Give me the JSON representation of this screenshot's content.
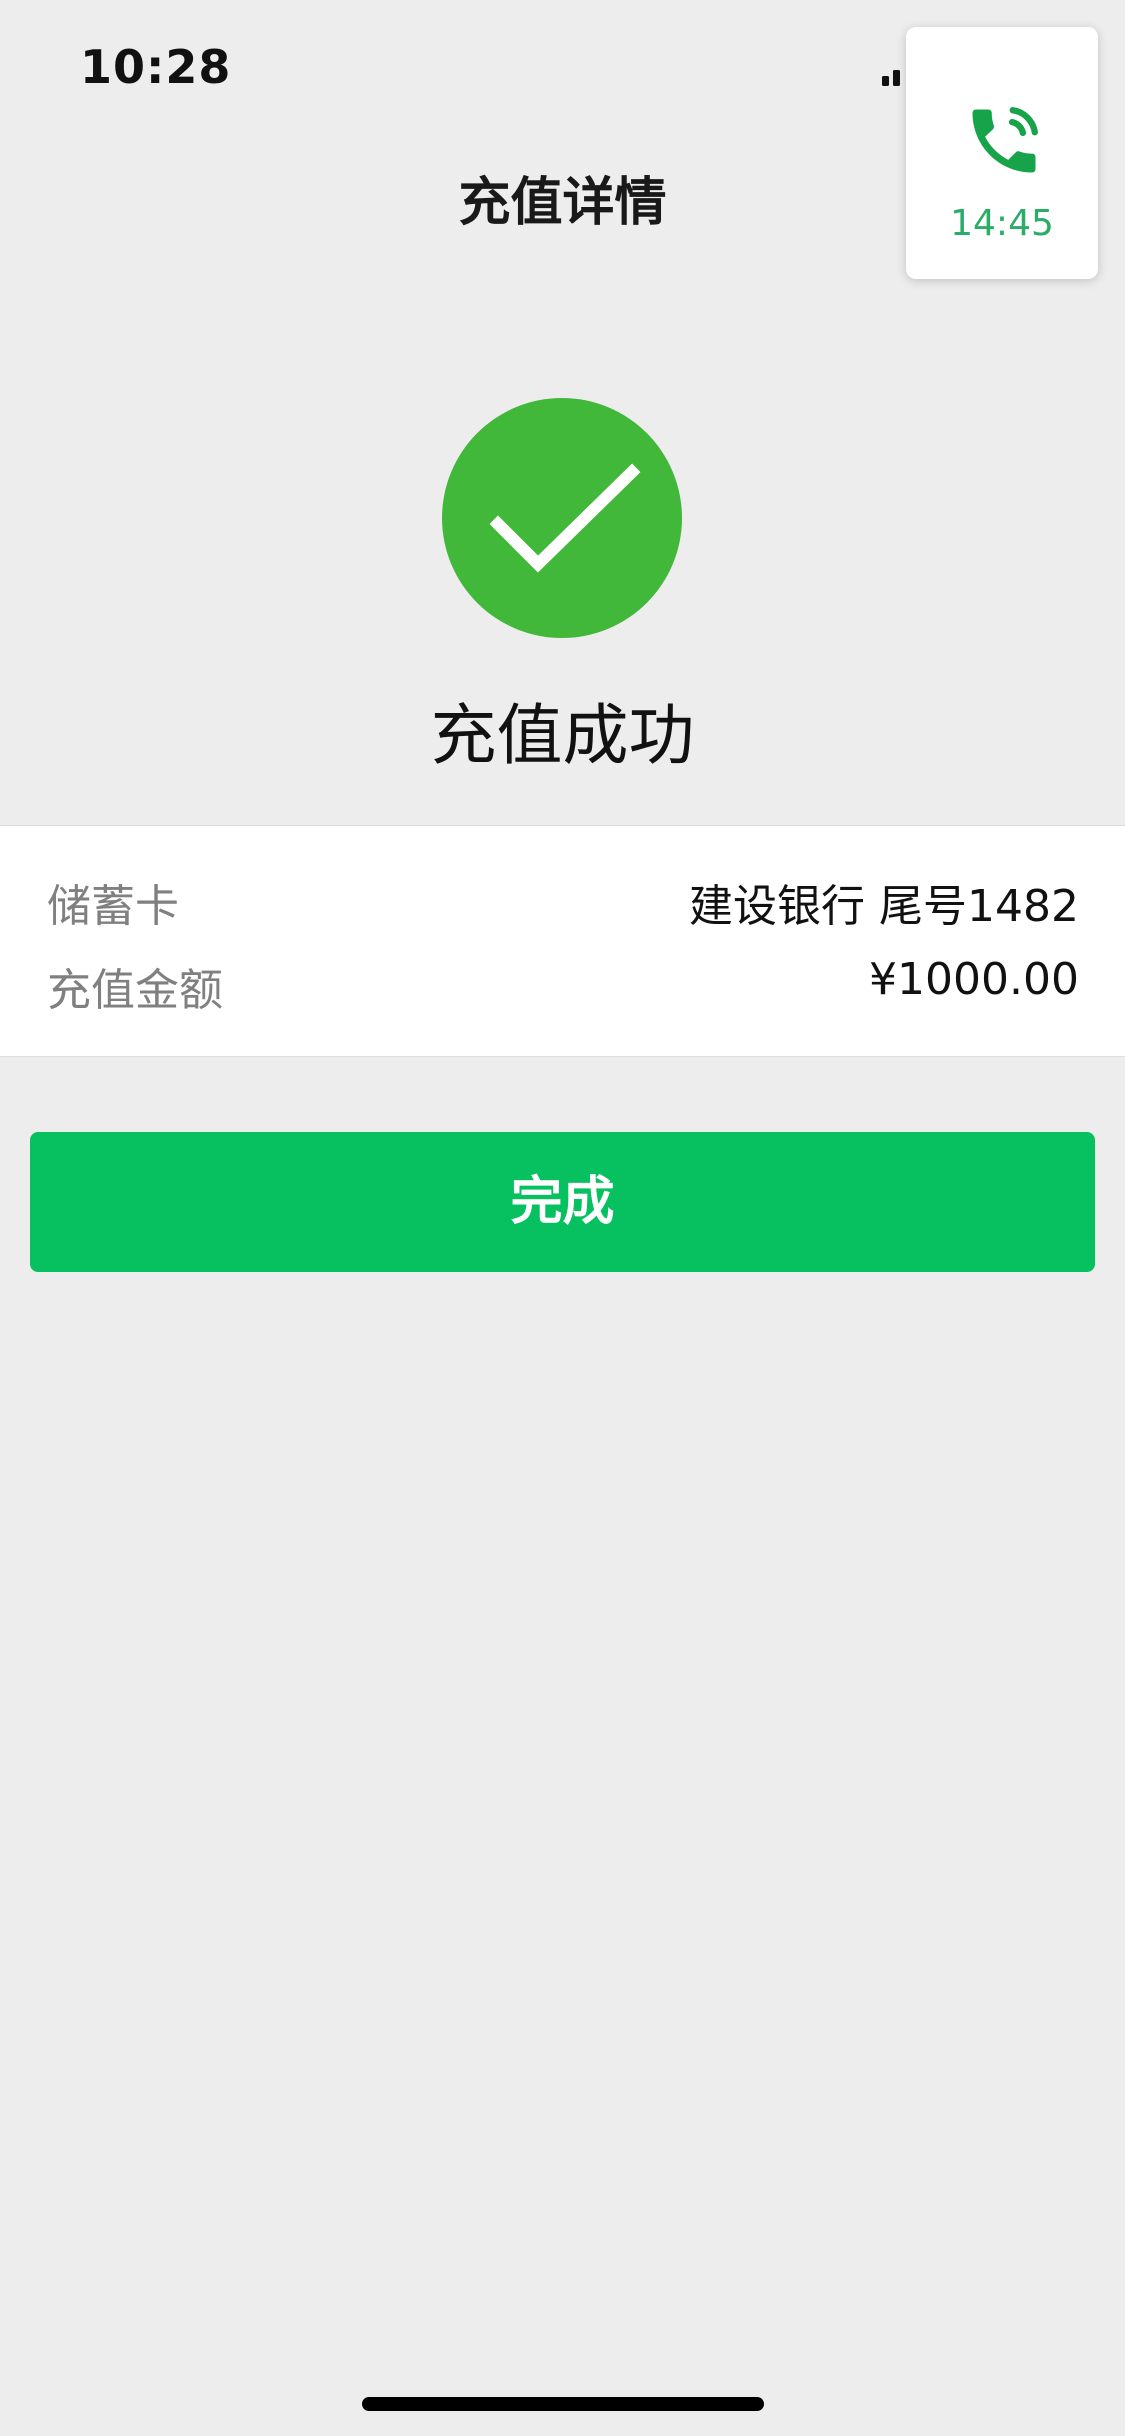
{
  "status_bar": {
    "time": "10:28"
  },
  "nav": {
    "title": "充值详情"
  },
  "call": {
    "duration": "14:45",
    "icon": "phone-icon"
  },
  "result": {
    "icon": "check-circle-icon",
    "title": "充值成功"
  },
  "details": {
    "rows": [
      {
        "label": "储蓄卡",
        "value": "建设银行 尾号1482"
      },
      {
        "label": "充值金额",
        "value": "¥1000.00"
      }
    ]
  },
  "actions": {
    "done_label": "完成"
  },
  "colors": {
    "brand_green": "#07c160",
    "success_green": "#42b83a",
    "call_green": "#2aae67",
    "background": "#ededed"
  }
}
